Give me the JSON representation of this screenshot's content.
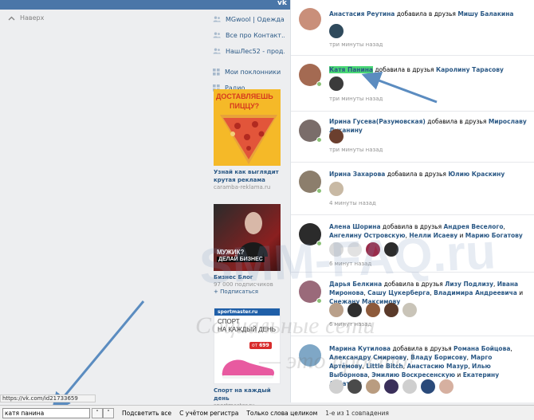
{
  "topbar": {
    "logo": "vk",
    "right_label": ""
  },
  "back_to_top": "Наверх",
  "left_menu": {
    "groups": [
      {
        "label": "MGwool | Одежда...",
        "icon": "people-icon"
      },
      {
        "label": "Все про Контакт...",
        "icon": "people-icon"
      },
      {
        "label": "НашЛес52 - прод...",
        "icon": "people-icon"
      }
    ],
    "extra": [
      {
        "label": "Мои поклонники",
        "badge": "8",
        "icon": "apps-icon"
      },
      {
        "label": "Радио",
        "icon": "apps-icon"
      }
    ]
  },
  "ads": [
    {
      "pic_text_1": "ДОСТАВЛЯЕШЬ",
      "pic_text_2": "ПИЦЦУ?",
      "title_1": "Узнай как выглядит",
      "title_2": "крутая реклама",
      "sub": "caramba-reklama.ru"
    },
    {
      "pic_text_1": "МУЖИК?",
      "pic_text_2": "ДЕЛАЙ БИЗНЕС",
      "title_1": "Бизнес Блог",
      "title_2": "",
      "sub": "97 000 подписчиков",
      "action": "+ Подписаться"
    },
    {
      "brand": "sportmaster.ru",
      "pic_text_1": "СПОРТ",
      "pic_text_2": "НА КАЖДЫЙ ДЕНЬ",
      "price_prefix": "от",
      "price": "699",
      "title_1": "Спорт на каждый день",
      "title_2": "",
      "sub": "sportmaster.ru"
    }
  ],
  "feed": [
    {
      "who": "Анастасия Реутина",
      "verb": "добавила в друзья",
      "targets": [
        "Мишу Балакина"
      ],
      "time": "три минуты назад",
      "avatar_color": "#c98f7a",
      "thumbs": [
        "#2f4a5c"
      ],
      "online": false
    },
    {
      "who": "Катя Панина",
      "verb": "добавила в друзья",
      "targets": [
        "Каролину Тарасову"
      ],
      "time": "три минуты назад",
      "avatar_color": "#a46a52",
      "thumbs": [
        "#3b3b3b"
      ],
      "online": true
    },
    {
      "who": "Ирина Гусева(Разумовская)",
      "verb": "добавила в друзья",
      "targets": [
        "Мирославу Луканину"
      ],
      "time": "три минуты назад",
      "avatar_color": "#7a6d6a",
      "thumbs": [
        "#6b3f2e"
      ],
      "online": true
    },
    {
      "who": "Ирина Захарова",
      "verb": "добавила в друзья",
      "targets": [
        "Юлию Краскину"
      ],
      "time": "4 минуты назад",
      "avatar_color": "#8c7e6c",
      "thumbs": [
        "#c8b9a4"
      ],
      "online": true
    },
    {
      "who": "Алена Шорина",
      "verb": "добавила в друзья",
      "targets": [
        "Андрея Веселого",
        "Ангелину Островскую",
        "Нелли Исаеву",
        "Марию Богатову"
      ],
      "joiners": [
        ", ",
        ", ",
        " и "
      ],
      "time": "6 минут назад",
      "avatar_color": "#2b2b2b",
      "thumbs": [
        "#d9d9d9",
        "#e2e2e2",
        "#9a2c4a",
        "#2c2c2c"
      ],
      "online": true
    },
    {
      "who": "Дарья Белкина",
      "verb": "добавила в друзья",
      "targets": [
        "Лизу Подлизу",
        "Ивана Миронова",
        "Сашу Цукерберга",
        "Владимира Андреевича",
        "Снежану Максимову"
      ],
      "joiners": [
        ", ",
        ", ",
        ", ",
        " и "
      ],
      "time": "6 минут назад",
      "avatar_color": "#9a6a7a",
      "thumbs": [
        "#b9a08a",
        "#2f2f2f",
        "#8d5a3b",
        "#5a3a2a",
        "#c9c4b8"
      ],
      "online": true
    },
    {
      "who": "Марина Кутилова",
      "verb": "добавила в друзья",
      "targets": [
        "Романа Бойцова",
        "Александру Смирнову",
        "Владу Борисову",
        "Марго Артёмову",
        "Little Bitch",
        "Анастасию Мазур",
        "Илью Выборнова",
        "Эмилию Воскресенскую",
        "Екатерину Арбатову"
      ],
      "joiners": [
        ", ",
        ", ",
        ", ",
        ", ",
        ", ",
        ", ",
        ", ",
        " и "
      ],
      "time": "",
      "avatar_color": "#7fa7c6",
      "thumbs": [
        "#d0d0d0",
        "#4a4a4a",
        "#b99c80",
        "#3a2f5a",
        "#cfcfcf",
        "#2a4a7a",
        "#d6b0a0"
      ],
      "online": false
    }
  ],
  "status_url": "https://vk.com/id21733659",
  "find": {
    "value": "катя панина",
    "prev_label": "˄",
    "next_label": "˅",
    "highlight_all": "Подсветить все",
    "match_case": "С учётом регистра",
    "whole_words": "Только слова целиком",
    "result": "1-е из 1 совпадения"
  },
  "watermark": {
    "line1": "SMM-FAQ.ru",
    "line2": "Социальные сети",
    "line3": "— это просто!"
  },
  "colors": {
    "accent": "#4a76a8",
    "link": "#2a5885",
    "highlight": "#4bd876",
    "arrow": "#5b8cc0"
  }
}
